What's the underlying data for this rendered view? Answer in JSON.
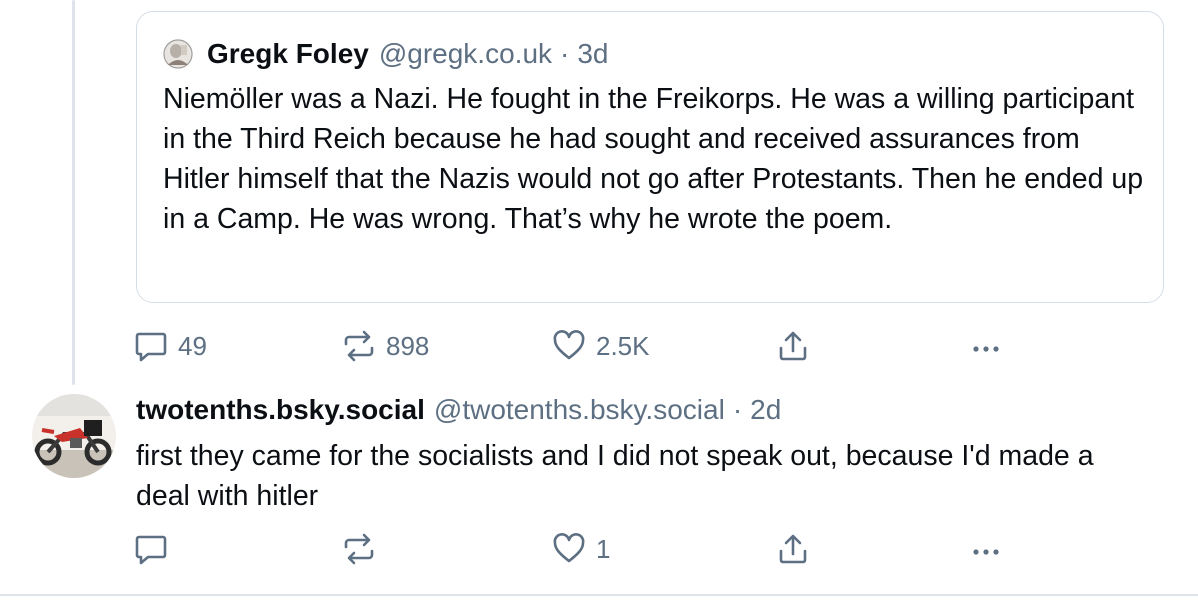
{
  "quoted_post": {
    "author_name": "Gregk Foley",
    "author_handle": "@gregk.co.uk",
    "separator": "·",
    "time": "3d",
    "text": "Niemöller was a Nazi. He fought in the Freikorps. He was a willing participant in the Third Reich because he had sought and received assurances from Hitler himself that the Nazis would not go after Protestants. Then he ended up in a Camp. He was wrong. That’s why he wrote the poem."
  },
  "quoted_post_actions": {
    "reply_count": "49",
    "repost_count": "898",
    "like_count": "2.5K"
  },
  "reply_post": {
    "author_name": "twotenths.bsky.social",
    "author_handle": "@twotenths.bsky.social",
    "separator": "·",
    "time": "2d",
    "text": "first they came for the socialists and I did not speak out, because I'd made a deal with hitler"
  },
  "reply_post_actions": {
    "reply_count": "",
    "repost_count": "",
    "like_count": "1"
  },
  "icons": {
    "reply": "reply-icon",
    "repost": "repost-icon",
    "like": "heart-icon",
    "share": "share-icon",
    "more": "more-options-icon"
  },
  "colors": {
    "text": "#0b0f14",
    "muted": "#5d6f82",
    "border": "#d6dde5"
  }
}
